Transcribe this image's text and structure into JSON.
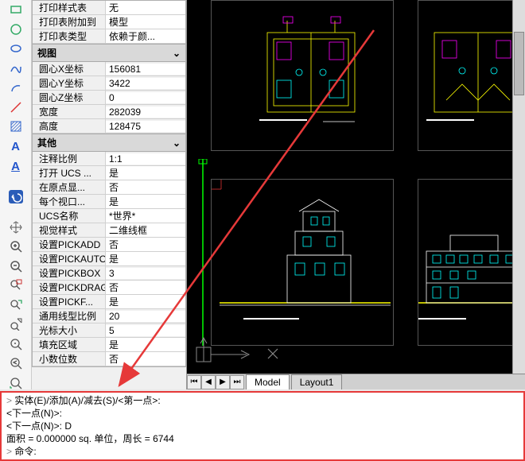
{
  "groups": [
    {
      "title": "",
      "rows": [
        {
          "k": "打印样式表",
          "v": "无"
        },
        {
          "k": "打印表附加到",
          "v": "模型"
        },
        {
          "k": "打印表类型",
          "v": "依赖于颜..."
        }
      ]
    },
    {
      "title": "视图",
      "rows": [
        {
          "k": "圆心X坐标",
          "v": "156081"
        },
        {
          "k": "圆心Y坐标",
          "v": "3422"
        },
        {
          "k": "圆心Z坐标",
          "v": "0"
        },
        {
          "k": "宽度",
          "v": "282039"
        },
        {
          "k": "高度",
          "v": "128475"
        }
      ]
    },
    {
      "title": "其他",
      "rows": [
        {
          "k": "注释比例",
          "v": "1:1"
        },
        {
          "k": "打开 UCS ...",
          "v": "是"
        },
        {
          "k": "在原点显...",
          "v": "否"
        },
        {
          "k": "每个视口...",
          "v": "是"
        },
        {
          "k": "UCS名称",
          "v": "*世界*"
        },
        {
          "k": "视觉样式",
          "v": "二维线框"
        },
        {
          "k": "设置PICKADD",
          "v": "否"
        },
        {
          "k": "设置PICKAUTO",
          "v": "是"
        },
        {
          "k": "设置PICKBOX",
          "v": "3"
        },
        {
          "k": "设置PICKDRAG",
          "v": "否"
        },
        {
          "k": "设置PICKF...",
          "v": "是"
        },
        {
          "k": "通用线型比例",
          "v": "20"
        },
        {
          "k": "光标大小",
          "v": "5"
        },
        {
          "k": "填充区域",
          "v": "是"
        },
        {
          "k": "小数位数",
          "v": "否"
        }
      ]
    }
  ],
  "tabs": {
    "model": "Model",
    "layout": "Layout1"
  },
  "cmd": {
    "l1": "实体(E)/添加(A)/减去(S)/<第一点>:",
    "l2": "<下一点(N)>:",
    "l3": "<下一点(N)>: D",
    "l4": "面积 = 0.000000 sq. 单位，周长 = 6744",
    "l5": "命令:"
  },
  "icons": [
    "rect",
    "circle",
    "spline",
    "arc",
    "hatch",
    "dim",
    "fill",
    "textA",
    "textA2",
    "undo",
    "pan",
    "zoomin",
    "zoomout",
    "zoomwin",
    "zoomall",
    "zoomext",
    "zoomprev",
    "zoomobj",
    "regen"
  ]
}
